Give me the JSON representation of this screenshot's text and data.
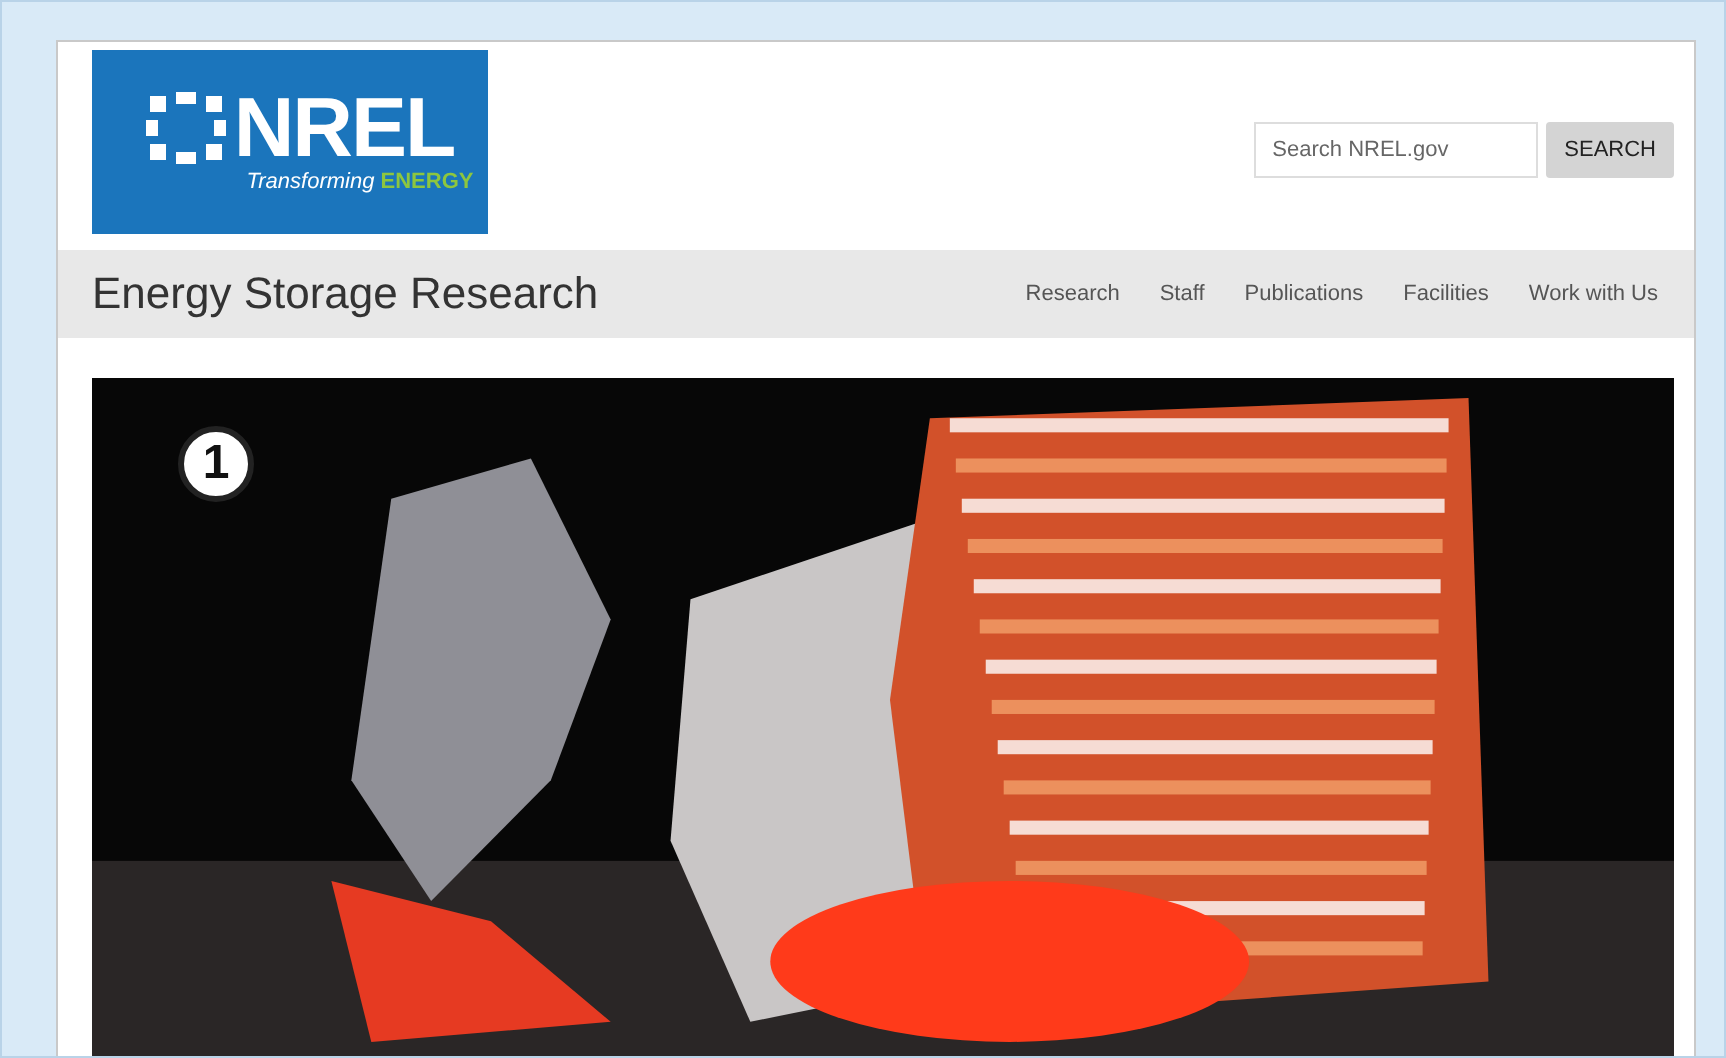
{
  "logo": {
    "wordmark": "NREL",
    "tagline": "Transforming",
    "tagline_highlight": "ENERGY"
  },
  "search": {
    "placeholder": "Search NREL.gov",
    "button": "SEARCH"
  },
  "header": {
    "title": "Energy Storage Research"
  },
  "nav": [
    {
      "label": "Research"
    },
    {
      "label": "Staff"
    },
    {
      "label": "Publications"
    },
    {
      "label": "Facilities"
    },
    {
      "label": "Work with Us"
    }
  ],
  "hero": {
    "kind": "picture",
    "callout": "1"
  }
}
